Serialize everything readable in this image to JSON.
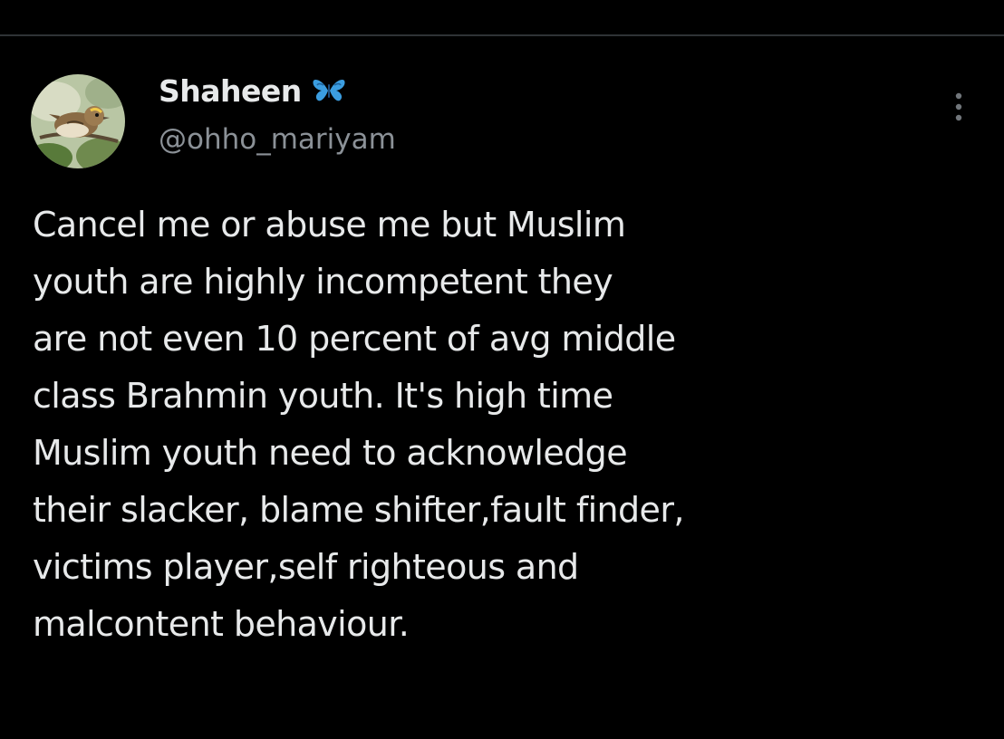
{
  "tweet": {
    "display_name": "Shaheen",
    "name_badge": "butterfly-emoji",
    "handle": "@ohho_mariyam",
    "more_icon": "more-vertical-icon",
    "text": "Cancel me or abuse me but Muslim\nyouth are highly incompetent they\nare not even 10 percent of avg middle\nclass Brahmin youth. It's high time\nMuslim youth need to acknowledge\ntheir slacker, blame shifter,fault finder,\nvictims player,self righteous and\nmalcontent behaviour."
  },
  "colors": {
    "background": "#000000",
    "text_primary": "#e7e9ea",
    "text_secondary": "#8b9197",
    "divider": "#2f3336",
    "badge": "#3b9de0"
  }
}
